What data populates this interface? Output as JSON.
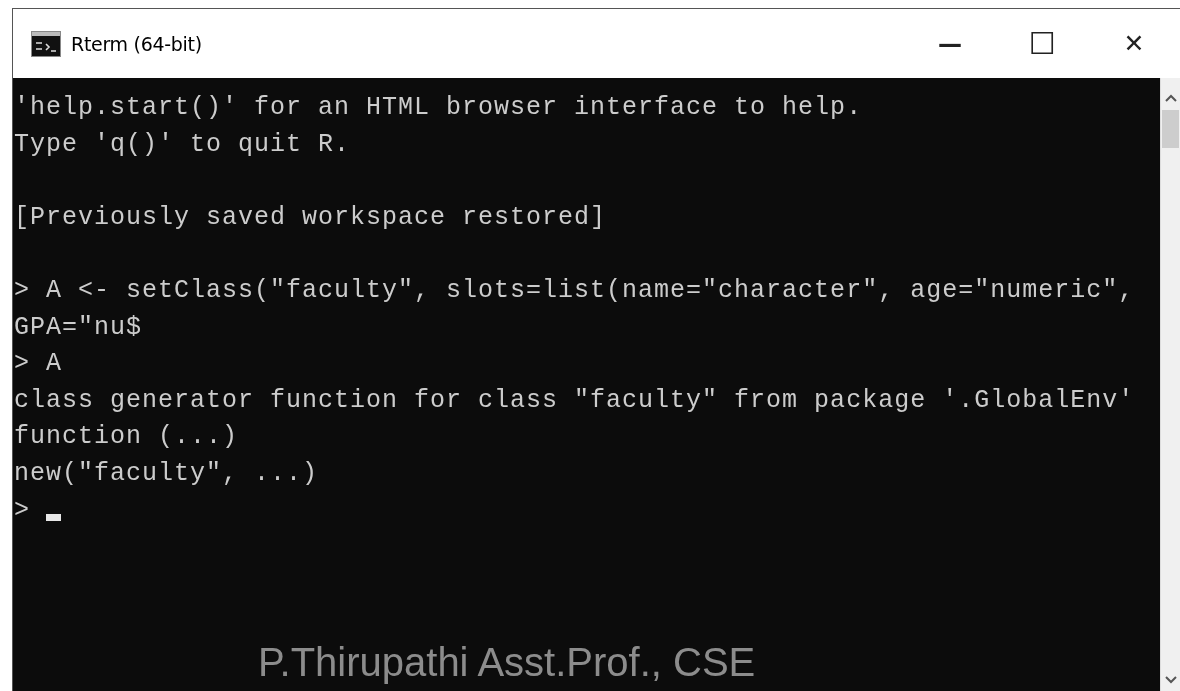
{
  "window": {
    "title": "Rterm (64-bit)",
    "controls": [
      {
        "kind": "minimize",
        "label": "—"
      },
      {
        "kind": "maximize",
        "label": "☐"
      },
      {
        "kind": "close",
        "label": "✕"
      }
    ]
  },
  "console": {
    "blocks": [
      [
        "'help.start()' for an HTML browser interface to help.",
        "Type 'q()' to quit R."
      ],
      [
        "[Previously saved workspace restored]"
      ],
      [
        "> A <- setClass(\"faculty\", slots=list(name=\"character\", age=\"numeric\",",
        "GPA=\"nu$",
        "> A",
        "class generator function for class \"faculty\" from package '.GlobalEnv'",
        "function (...)",
        "new(\"faculty\", ...)",
        ">"
      ]
    ],
    "cursor": true
  },
  "footer": "P.Thirupathi Asst.Prof., CSE"
}
